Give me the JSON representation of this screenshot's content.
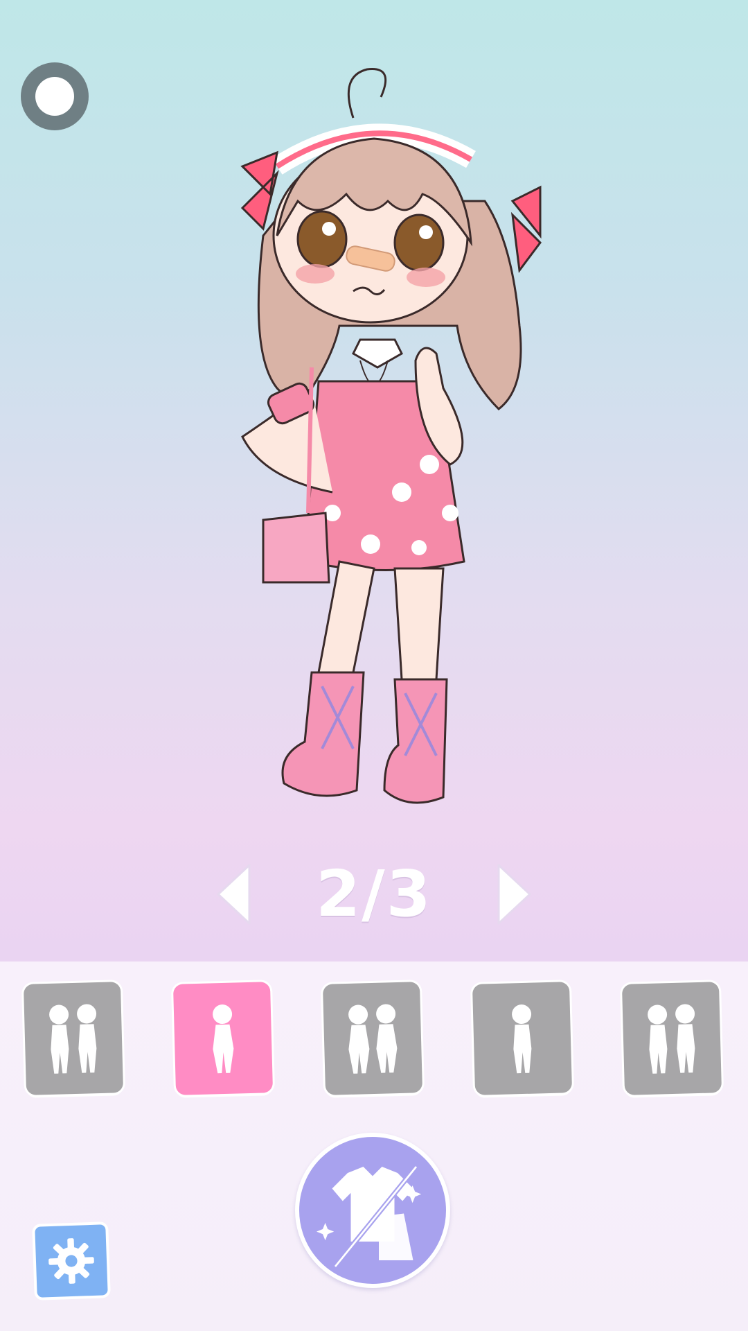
{
  "top": {
    "record_icon": "record-circle-icon"
  },
  "pager": {
    "indicator": "2/3",
    "prev_icon": "chevron-left-icon",
    "next_icon": "chevron-right-icon"
  },
  "modes": [
    {
      "icon": "couple-silhouette-icon",
      "active": false
    },
    {
      "icon": "single-girl-silhouette-icon",
      "active": true
    },
    {
      "icon": "two-girls-silhouette-icon",
      "active": false
    },
    {
      "icon": "single-boy-silhouette-icon",
      "active": false
    },
    {
      "icon": "two-boys-silhouette-icon",
      "active": false
    }
  ],
  "actions": {
    "wardrobe_icon": "outfit-swap-icon",
    "settings_icon": "gear-icon"
  },
  "colors": {
    "active_mode": "#ff8cc4",
    "inactive_mode": "#a7a6a8",
    "wardrobe": "#a8a2ee",
    "settings": "#7fb2f3"
  }
}
